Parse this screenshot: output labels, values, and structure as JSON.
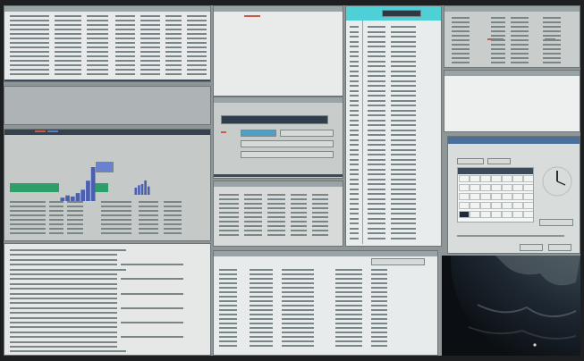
{
  "window_titles": {
    "top_left": "",
    "top_mid": "",
    "tall_list": "",
    "top_right": "",
    "dialog": "",
    "bottom_list": ""
  },
  "status_indicators": {
    "alert_color": "#c43a2a",
    "green_color": "#2f9f6a",
    "accent_blue": "#4a5fb0"
  },
  "charts": {
    "histogram": {
      "type": "bar",
      "values": [
        3,
        5,
        4,
        7,
        10,
        18,
        30
      ]
    },
    "secondary": {
      "type": "bar",
      "values": [
        6,
        8,
        9,
        12,
        7
      ]
    }
  },
  "calendar": {
    "days": [
      "",
      "",
      "",
      "",
      "",
      "",
      "",
      "",
      "",
      "",
      "",
      "",
      "",
      "",
      "",
      "",
      "",
      "",
      "",
      "",
      "",
      "",
      "",
      "",
      "",
      "",
      "",
      "",
      "",
      "",
      "",
      "",
      "",
      "",
      ""
    ],
    "highlight_index": 28
  }
}
